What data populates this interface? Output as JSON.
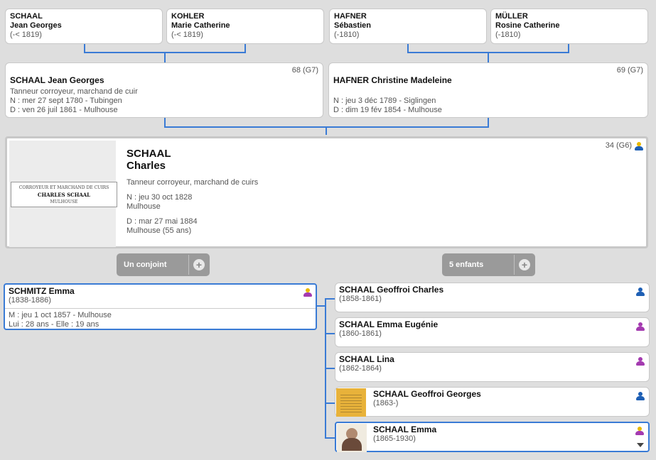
{
  "grandparents": [
    {
      "lastname": "SCHAAL",
      "firstname": "Jean Georges",
      "dates": "(-< 1819)"
    },
    {
      "lastname": "KOHLER",
      "firstname": "Marie Catherine",
      "dates": "(-< 1819)"
    },
    {
      "lastname": "HAFNER",
      "firstname": "Sébastien",
      "dates": "(-1810)"
    },
    {
      "lastname": "MÜLLER",
      "firstname": "Rosine Catherine",
      "dates": "(-1810)"
    }
  ],
  "parents": [
    {
      "name": "SCHAAL Jean Georges",
      "number": "68 (G7)",
      "occupation": "Tanneur corroyeur, marchand de cuir",
      "birth": "N : mer 27 sept 1780 - Tubingen",
      "death": "D : ven 26 juil 1861 - Mulhouse"
    },
    {
      "name": "HAFNER Christine Madeleine",
      "number": "69 (G7)",
      "occupation": "",
      "birth": "N : jeu 3 déc 1789 - Siglingen",
      "death": "D : dim 19 fév 1854 - Mulhouse"
    }
  ],
  "main": {
    "surname": "SCHAAL",
    "firstname": "Charles",
    "number": "34 (G6)",
    "occupation": "Tanneur corroyeur, marchand de cuirs",
    "birth_date": "N : jeu 30 oct 1828",
    "birth_place": "Mulhouse",
    "death_date": "D : mar 27 mai 1884",
    "death_place": "Mulhouse (55 ans)",
    "document": {
      "line1": "CORROYEUR ET MARCHAND DE CUIRS",
      "line2": "CHARLES SCHAAL",
      "line3": "MULHOUSE"
    }
  },
  "buttons": {
    "spouse_label": "Un conjoint",
    "children_label": "5 enfants",
    "plus": "+"
  },
  "spouse": {
    "name": "SCHMITZ Emma",
    "dates": "(1838-1886)",
    "marriage": "M : jeu 1 oct 1857 - Mulhouse",
    "ages": "Lui : 28 ans - Elle : 19 ans"
  },
  "children": [
    {
      "name": "SCHAAL Geoffroi Charles",
      "dates": "(1858-1861)",
      "gender": "male"
    },
    {
      "name": "SCHAAL Emma Eugénie",
      "dates": "(1860-1861)",
      "gender": "female"
    },
    {
      "name": "SCHAAL Lina",
      "dates": "(1862-1864)",
      "gender": "female"
    },
    {
      "name": "SCHAAL Geoffroi Georges",
      "dates": "(1863-)",
      "gender": "male"
    },
    {
      "name": "SCHAAL Emma",
      "dates": "(1865-1930)",
      "gender": "female"
    }
  ],
  "colors": {
    "male": "#1e5fb4",
    "female": "#a43bb0",
    "self": "#e8b800",
    "link": "#3a7bd5"
  }
}
